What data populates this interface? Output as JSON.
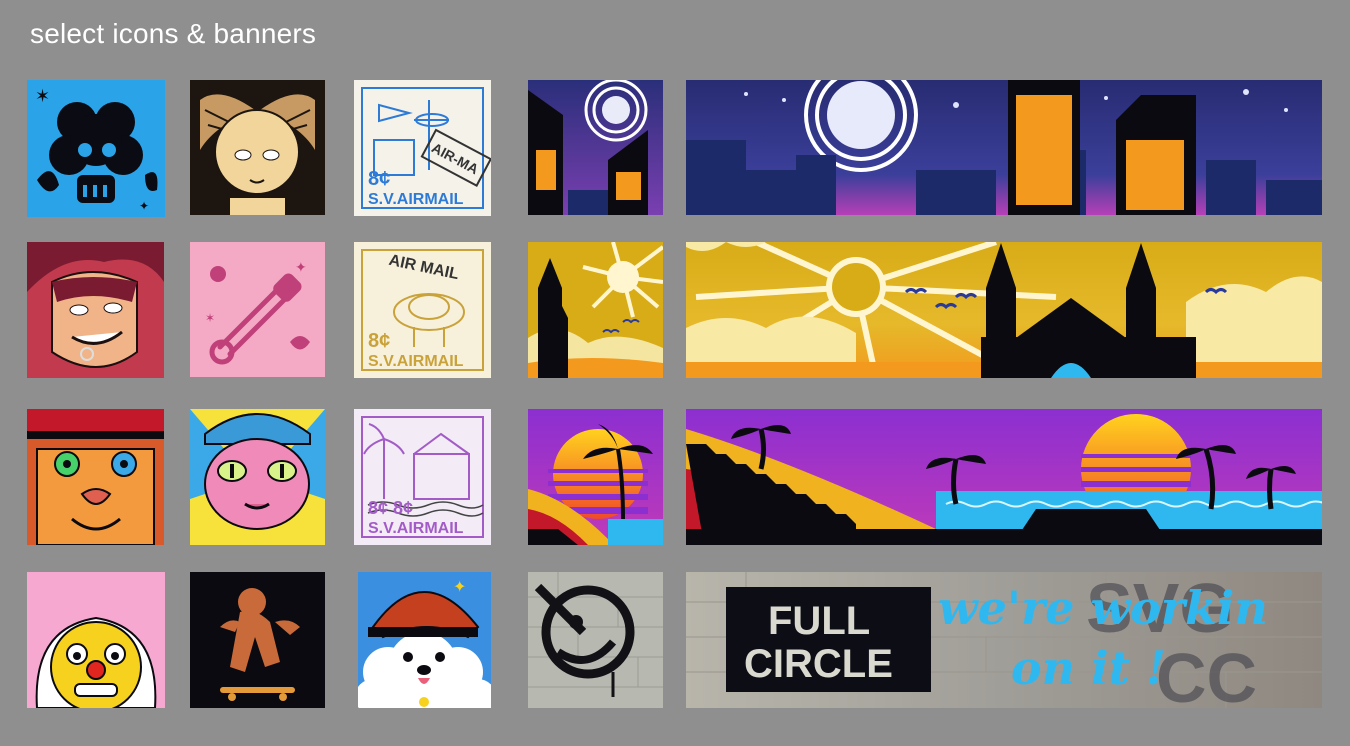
{
  "page": {
    "title": "select icons & banners",
    "background": "#8f8f8f"
  },
  "stamps": [
    {
      "value": "8¢",
      "label": "S.V.AIRMAIL",
      "cancel": "AIR-MA",
      "color": "#2d7bd6"
    },
    {
      "value": "8¢",
      "label": "S.V.AIRMAIL",
      "cancel": "AIR MAIL",
      "color": "#c9a23a"
    },
    {
      "value": "8¢ 8¢",
      "label": "S.V.AIRMAIL",
      "cancel": "",
      "color": "#a35cc7"
    }
  ],
  "banner4": {
    "sign": "FULL CIRCLE",
    "sign_line1": "FULL",
    "sign_line2": "CIRCLE",
    "graffiti_line1": "we're workin",
    "graffiti_line2": "on it !",
    "graffiti_color": "#2fb8f0"
  },
  "colors": {
    "night_sky": "#2a2f7a",
    "sunset_purple": "#8c2fd1",
    "gold": "#d8ac17",
    "orange": "#f39a1e"
  }
}
